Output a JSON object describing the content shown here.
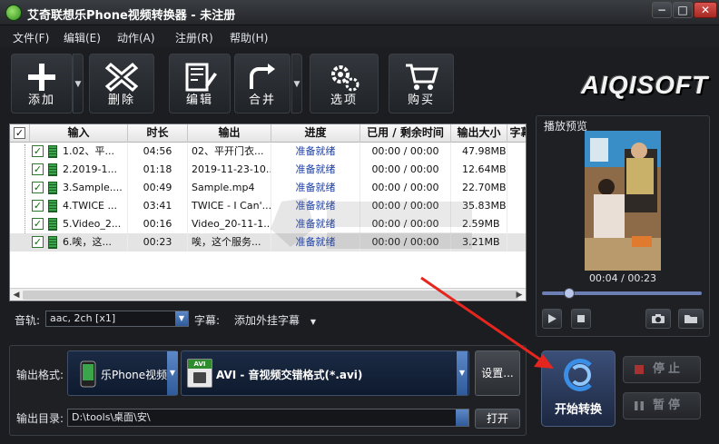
{
  "window": {
    "title": "艾奇联想乐Phone视频转换器 - 未注册",
    "controls": [
      "−",
      "□",
      "✕"
    ]
  },
  "menu": [
    "文件(F)",
    "编辑(E)",
    "动作(A)",
    "注册(R)",
    "帮助(H)"
  ],
  "toolbar": {
    "add": "添加",
    "delete": "删除",
    "edit": "编辑",
    "merge": "合并",
    "options": "选项",
    "buy": "购买",
    "logo": "AIQISOFT"
  },
  "file_list": {
    "columns": [
      "输入",
      "时长",
      "输出",
      "进度",
      "已用 / 剩余时间",
      "输出大小",
      "字幕"
    ],
    "rows": [
      {
        "input": "1.02、平...",
        "duration": "04:56",
        "output": "02、平开门衣...",
        "progress": "准备就绪",
        "time": "00:00 / 00:00",
        "size": "47.98MB"
      },
      {
        "input": "2.2019-1...",
        "duration": "01:18",
        "output": "2019-11-23-10...",
        "progress": "准备就绪",
        "time": "00:00 / 00:00",
        "size": "12.64MB"
      },
      {
        "input": "3.Sample....",
        "duration": "00:49",
        "output": "Sample.mp4",
        "progress": "准备就绪",
        "time": "00:00 / 00:00",
        "size": "22.70MB"
      },
      {
        "input": "4.TWICE ...",
        "duration": "03:41",
        "output": "TWICE - I Can'...",
        "progress": "准备就绪",
        "time": "00:00 / 00:00",
        "size": "35.83MB"
      },
      {
        "input": "5.Video_2...",
        "duration": "00:16",
        "output": "Video_20-11-1...",
        "progress": "准备就绪",
        "time": "00:00 / 00:00",
        "size": "2.59MB"
      },
      {
        "input": "6.唉，这...",
        "duration": "00:23",
        "output": "唉，这个服务...",
        "progress": "准备就绪",
        "time": "00:00 / 00:00",
        "size": "3.21MB"
      }
    ]
  },
  "preview": {
    "title": "播放预览",
    "time": "00:04 / 00:23",
    "seek_fraction": 0.17
  },
  "audio": {
    "label": "音轨:",
    "value": "aac, 2ch [x1]",
    "subtitle_label": "字幕:",
    "subtitle_value": "添加外挂字幕"
  },
  "output": {
    "format_label": "输出格式:",
    "device": "乐Phone视频",
    "format": "AVI - 音视频交错格式(*.avi)",
    "format_badge": "AVI",
    "settings": "设置...",
    "dir_label": "输出目录:",
    "dir_value": "D:\\tools\\桌面\\安\\",
    "open": "打开"
  },
  "convert": {
    "start": "开始转换",
    "stop": "停止",
    "pause": "暂停"
  },
  "colors": {
    "accent": "#3a8ee6",
    "progress_text": "#1d3fa6",
    "arrow": "#e5261f"
  }
}
